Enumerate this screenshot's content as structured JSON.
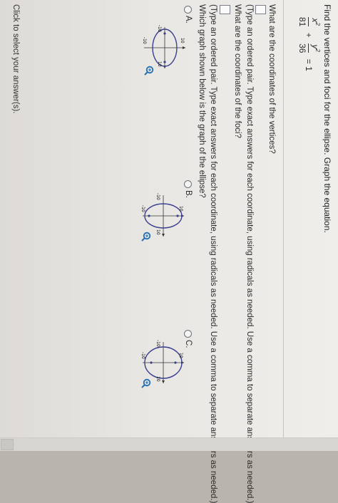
{
  "instruction": "Find the vertices and foci for the ellipse. Graph the equation.",
  "equation": {
    "x_term": "x",
    "y_term": "y",
    "power": "2",
    "x_den": "81",
    "y_den": "36",
    "plus": "+",
    "equals": "= 1"
  },
  "q1": {
    "question": "What are the coordinates of the vertices?",
    "hint": "(Type an ordered pair. Type exact answers for each coordinate, using radicals as needed. Use a comma to separate answers as needed.)"
  },
  "q2": {
    "question": "What are the coordinates of the foci?",
    "hint": "(Type an ordered pair. Type exact answers for each coordinate, using radicals as needed. Use a comma to separate answers as needed.)"
  },
  "q3": {
    "question": "Which graph shown below is the graph of the ellipse?",
    "options": [
      {
        "label": "A.",
        "ticks": {
          "top": "10",
          "left": "-10",
          "right": "10",
          "bottom": "-10"
        }
      },
      {
        "label": "B.",
        "ticks": {
          "top": "10",
          "left": "-10",
          "right": "10",
          "bottom": "-10"
        }
      },
      {
        "label": "C.",
        "ticks": {
          "top": "10",
          "left": "-10",
          "right": "10",
          "bottom": "-10"
        }
      }
    ]
  },
  "footer": "Click to select your answer(s).",
  "icons": {
    "zoom": "zoom-in-icon"
  },
  "colors": {
    "zoom_accent": "#1f6fb5",
    "ellipse": "#3b3f8f",
    "axis": "#333333"
  }
}
